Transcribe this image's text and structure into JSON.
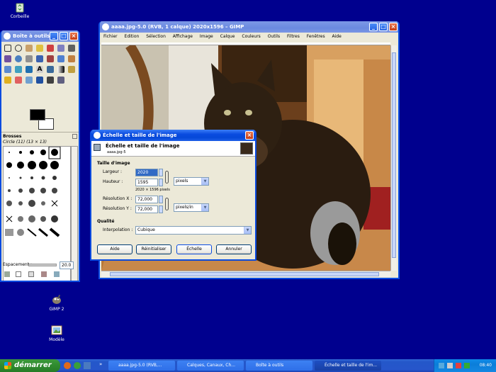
{
  "desktop": {
    "icons": [
      {
        "label": "Corbeille"
      },
      {
        "label": "GIMP 2"
      },
      {
        "label": "Modèle"
      }
    ]
  },
  "toolbox": {
    "title": "Boîte à outils",
    "brushes_title": "Brosses",
    "brush_name": "Circle (11) (13 × 13)",
    "spacing_label": "Espacement :",
    "spacing_value": "20.0"
  },
  "image_window": {
    "title": "aaaa.jpg-5.0 (RVB, 1 calque) 2020x1596 – GIMP",
    "menu": [
      "Fichier",
      "Edition",
      "Sélection",
      "Affichage",
      "Image",
      "Calque",
      "Couleurs",
      "Outils",
      "Filtres",
      "Fenêtres",
      "Aide"
    ]
  },
  "dialog": {
    "title": "Échelle et taille de l'image",
    "header_title": "Échelle et taille de l'image",
    "header_sub": "aaaa.jpg-5",
    "section_size": "Taille d'image",
    "width_label": "Largeur :",
    "width_value": "2020",
    "height_label": "Hauteur :",
    "height_value": "1595",
    "size_note": "2020 × 1596 pixels",
    "unit": "pixels",
    "xres_label": "Résolution X :",
    "xres_value": "72,000",
    "yres_label": "Résolution Y :",
    "yres_value": "72,000",
    "res_unit": "pixels/in",
    "section_quality": "Qualité",
    "interp_label": "Interpolation :",
    "interp_value": "Cubique",
    "buttons": {
      "help": "Aide",
      "reset": "Réinitialiser",
      "scale": "Échelle",
      "cancel": "Annuler"
    }
  },
  "taskbar": {
    "start": "démarrer",
    "tasks": [
      {
        "label": "aaaa.jpg-5.0 (RVB,..."
      },
      {
        "label": "Calques, Canaux, Ch..."
      },
      {
        "label": "Boîte à outils"
      },
      {
        "label": "Échelle et taille de l'im..."
      }
    ],
    "clock": "08:40"
  },
  "colors": {
    "desktop": "#00008e",
    "xp_blue": "#0a4be0",
    "dialog_bg": "#ece9d8"
  }
}
